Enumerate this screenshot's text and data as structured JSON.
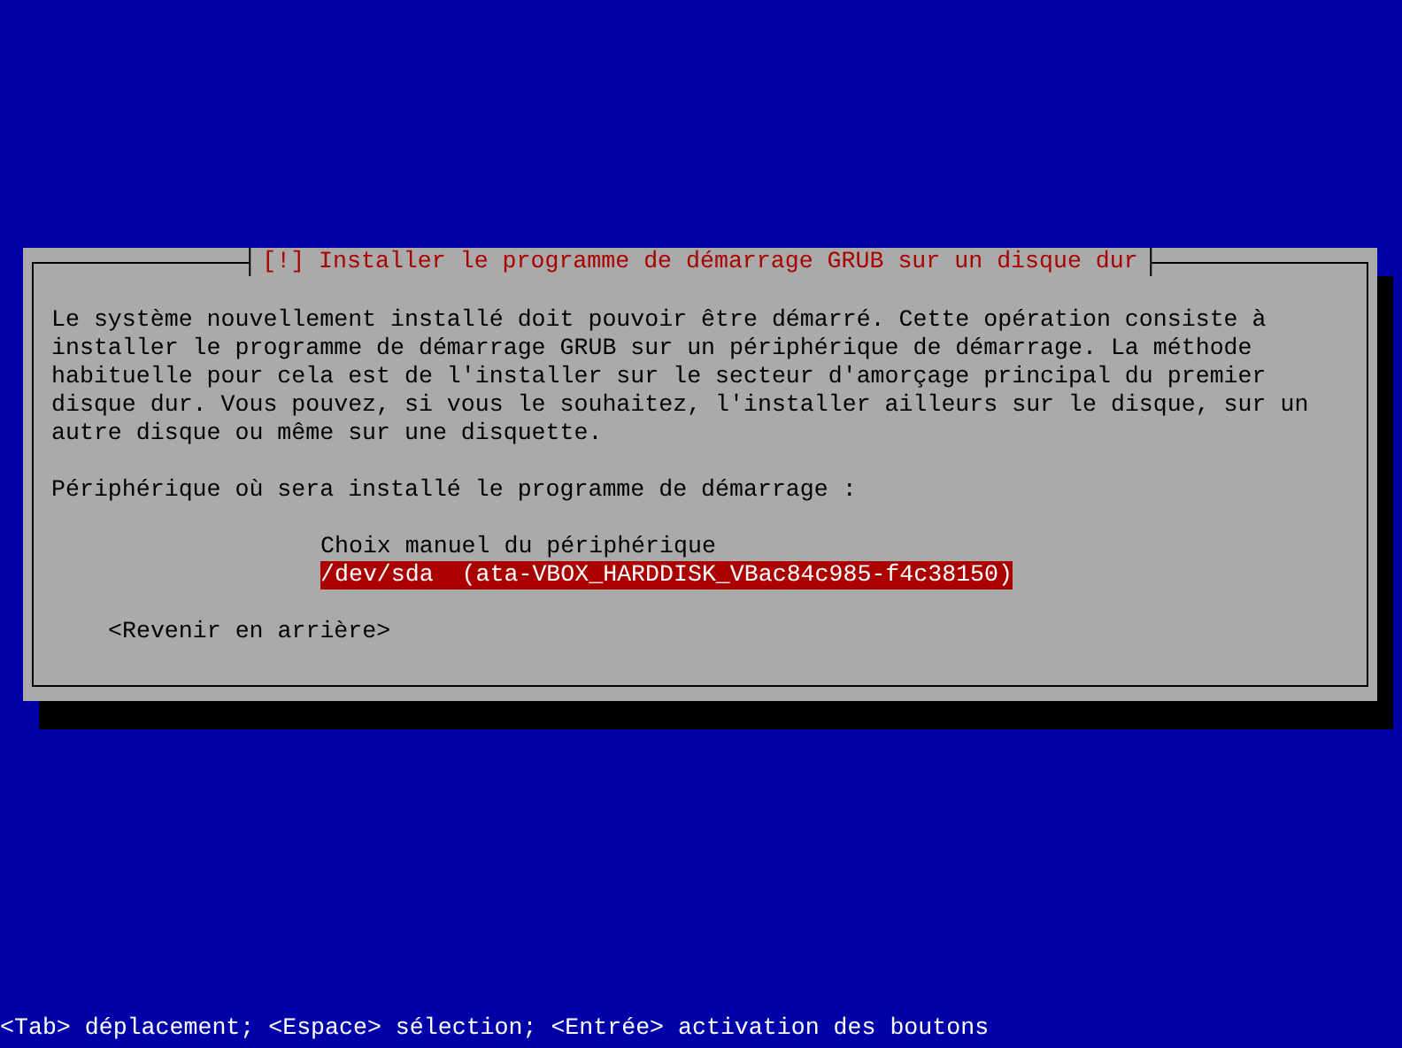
{
  "dialog": {
    "title": "[!] Installer le programme de démarrage GRUB sur un disque dur",
    "message": "Le système nouvellement installé doit pouvoir être démarré. Cette opération consiste à\ninstaller le programme de démarrage GRUB sur un périphérique de démarrage. La méthode\nhabituelle pour cela est de l'installer sur le secteur d'amorçage principal du premier\ndisque dur. Vous pouvez, si vous le souhaitez, l'installer ailleurs sur le disque, sur un\nautre disque ou même sur une disquette.",
    "prompt": "Périphérique où sera installé le programme de démarrage :",
    "options": [
      {
        "label": "Choix manuel du périphérique",
        "selected": false
      },
      {
        "label": "/dev/sda  (ata-VBOX_HARDDISK_VBac84c985-f4c38150)",
        "selected": true
      }
    ],
    "buttons": [
      {
        "label": "<Revenir en arrière>"
      }
    ]
  },
  "help_line": "<Tab> déplacement; <Espace> sélection; <Entrée> activation des boutons"
}
